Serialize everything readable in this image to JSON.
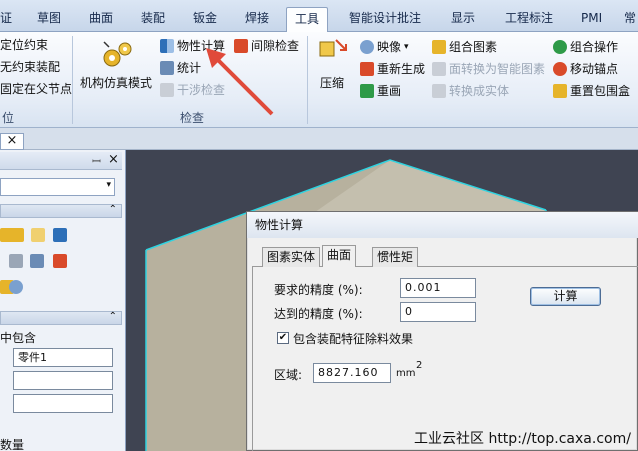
{
  "tabs": [
    "证",
    "草图",
    "曲面",
    "装配",
    "钣金",
    "焊接",
    "工具",
    "智能设计批注",
    "显示",
    "工程标注",
    "PMI",
    "常"
  ],
  "active_tab_index": 6,
  "ribbon": {
    "left_group": {
      "items": [
        "定位约束",
        "无约束装配",
        "固定在父节点"
      ],
      "label": "位"
    },
    "inspect_group": {
      "big_button": "机构仿真模式",
      "items": [
        "物性计算",
        "间隙检查",
        "统计",
        "干涉检查"
      ],
      "label": "检查"
    },
    "tools_group": {
      "shrink_label": "压缩",
      "items": [
        "映像",
        "重新生成",
        "重画",
        "组合图素",
        "面转换为智能图素",
        "转换成实体",
        "组合操作",
        "移动锚点",
        "重置包围盒"
      ]
    }
  },
  "doc_tab_close": "×",
  "panel": {
    "pin": "ꟷ",
    "close": "×",
    "contains_label": "中包含",
    "part_value": "零件1",
    "count_label": "数量"
  },
  "dialog": {
    "title": "物性计算",
    "tabs": [
      "图素实体",
      "曲面",
      "惯性矩"
    ],
    "active_tab_index": 1,
    "required_precision_label": "要求的精度 (%):",
    "required_precision_value": "0.001",
    "achieved_precision_label": "达到的精度 (%):",
    "achieved_precision_value": "0",
    "compute_button": "计算",
    "checkbox_label": "包含装配特征除料效果",
    "checkbox_checked": true,
    "area_label": "区域:",
    "area_value": "8827.160",
    "area_unit": "mm",
    "area_exponent": "2"
  },
  "watermark": "工业云社区 http://top.caxa.com/",
  "colors": {
    "accent": "#2d6fb8",
    "arrow": "#e04a3a",
    "edge_highlight": "#2fd3e0",
    "solid_face": "#b7b19e"
  }
}
